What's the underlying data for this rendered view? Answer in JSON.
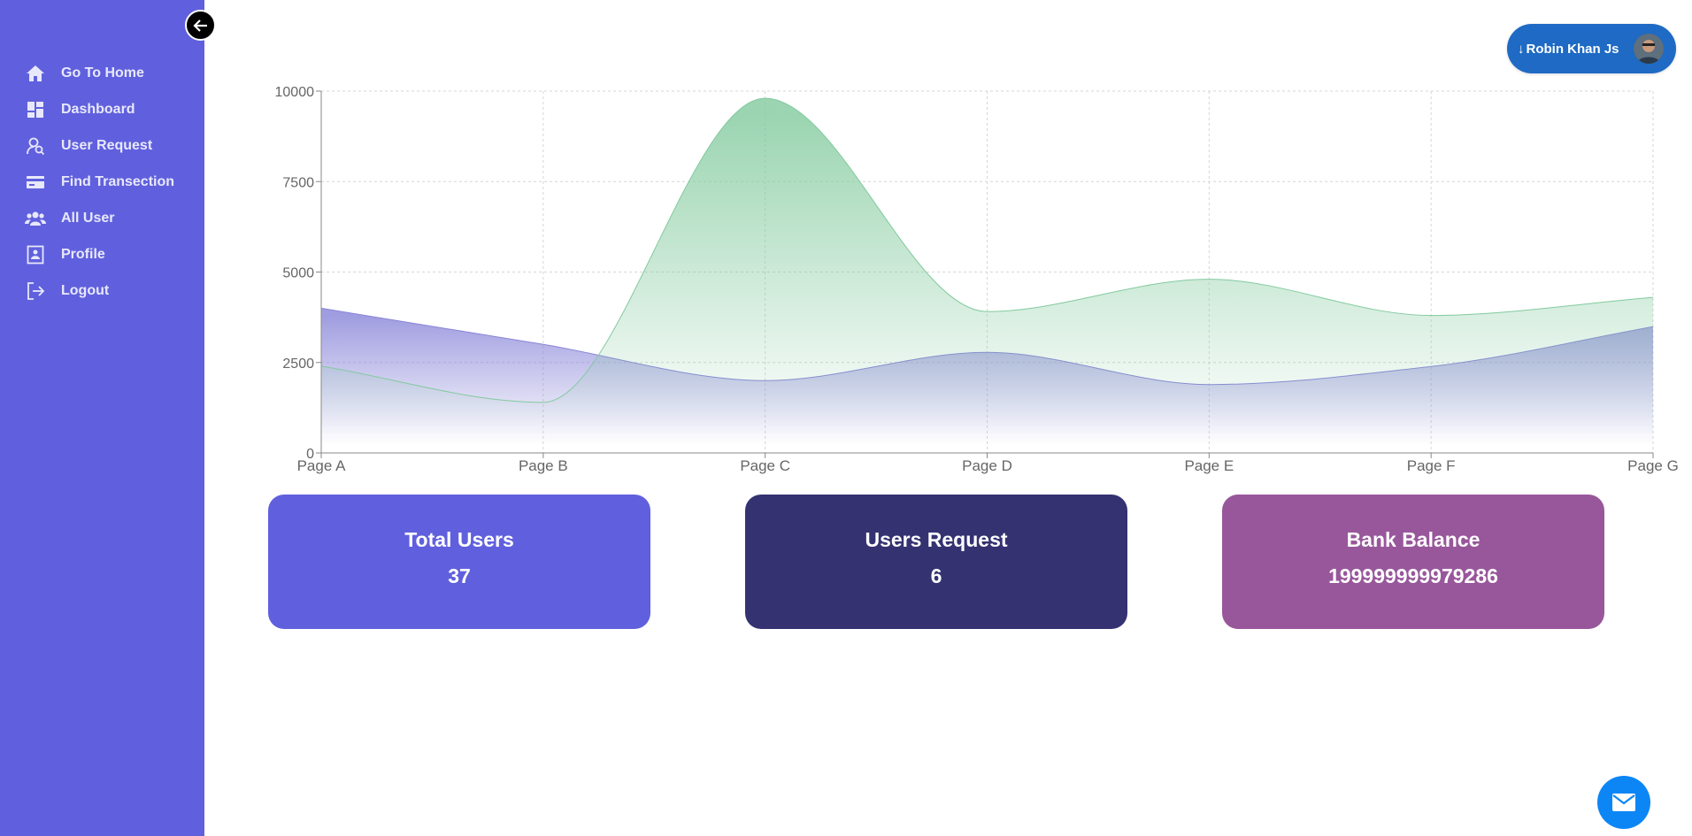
{
  "sidebar": {
    "background": "#6060de",
    "items": [
      {
        "label": "Go To Home",
        "icon": "home-icon"
      },
      {
        "label": "Dashboard",
        "icon": "dashboard-icon"
      },
      {
        "label": "User Request",
        "icon": "user-search-icon"
      },
      {
        "label": "Find Transection",
        "icon": "credit-card-icon"
      },
      {
        "label": "All User",
        "icon": "users-icon"
      },
      {
        "label": "Profile",
        "icon": "profile-icon"
      },
      {
        "label": "Logout",
        "icon": "logout-icon"
      }
    ]
  },
  "header": {
    "user_name": "Robin Khan Js",
    "arrow": "↓",
    "pill_color": "#1e6ac4"
  },
  "chart_data": {
    "type": "area",
    "categories": [
      "Page A",
      "Page B",
      "Page C",
      "Page D",
      "Page E",
      "Page F",
      "Page G"
    ],
    "yticks": [
      "0",
      "2500",
      "5000",
      "7500",
      "10000"
    ],
    "ylim": [
      0,
      10000
    ],
    "grid": true,
    "series": [
      {
        "values": [
          4000,
          3000,
          2000,
          2780,
          1890,
          2390,
          3490
        ],
        "color": "#8884d8"
      },
      {
        "values": [
          2400,
          1398,
          9800,
          3908,
          4800,
          3800,
          4300
        ],
        "color": "#82ca9d"
      }
    ]
  },
  "cards": [
    {
      "title": "Total Users",
      "value": "37",
      "color": "#6060de"
    },
    {
      "title": "Users Request",
      "value": "6",
      "color": "#343271"
    },
    {
      "title": "Bank Balance",
      "value": "199999999979286",
      "color": "#98579b"
    }
  ],
  "fab": {
    "icon": "mail-icon",
    "color": "#0d86f5"
  }
}
